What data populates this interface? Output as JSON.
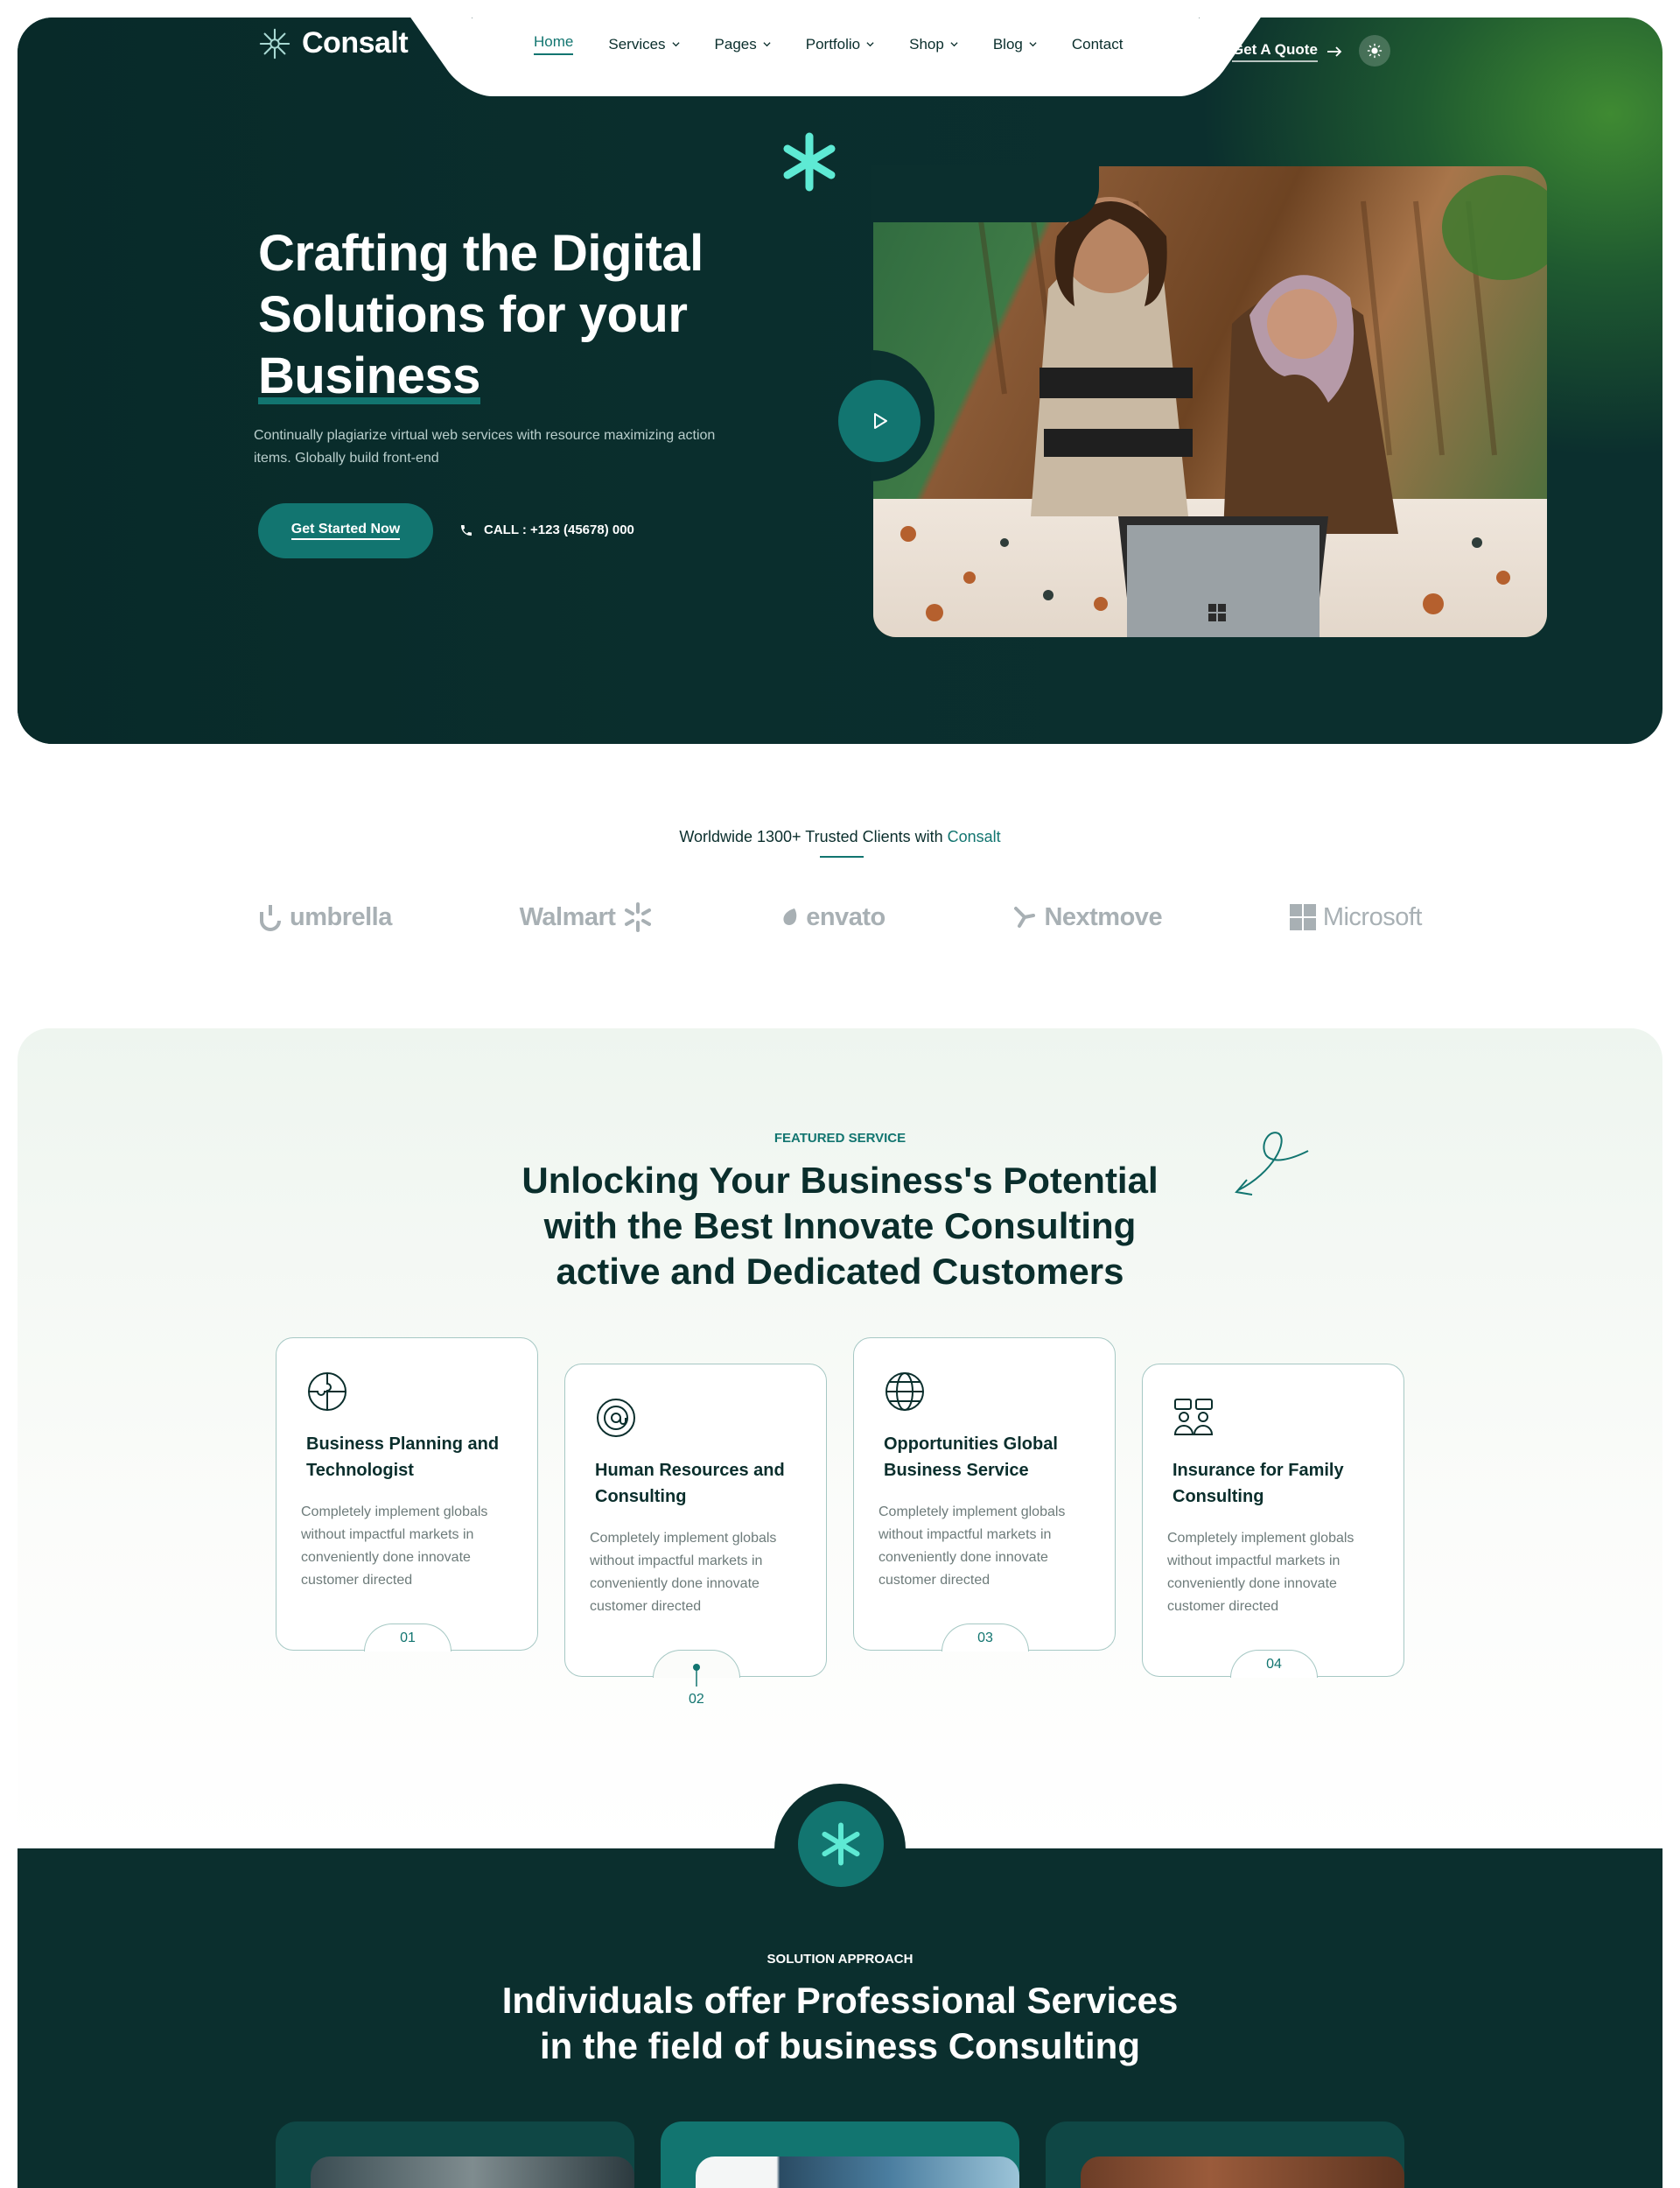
{
  "header": {
    "logo": "Consalt",
    "nav": [
      {
        "label": "Home",
        "active": true,
        "dropdown": false
      },
      {
        "label": "Services",
        "active": false,
        "dropdown": true
      },
      {
        "label": "Pages",
        "active": false,
        "dropdown": true
      },
      {
        "label": "Portfolio",
        "active": false,
        "dropdown": true
      },
      {
        "label": "Shop",
        "active": false,
        "dropdown": true
      },
      {
        "label": "Blog",
        "active": false,
        "dropdown": true
      },
      {
        "label": "Contact",
        "active": false,
        "dropdown": false
      }
    ],
    "quote_label": "Get A Quote",
    "icons": {
      "quote": "arrow-right-icon",
      "theme": "sun-icon"
    }
  },
  "hero": {
    "title_line1": "Crafting the Digital",
    "title_line2": "Solutions for your",
    "title_line3": "Business",
    "subtitle": "Continually plagiarize virtual web services with resource maximizing action items. Globally build front-end",
    "cta_label": "Get Started Now",
    "call_text": "CALL : +123 (45678) 000",
    "icons": {
      "play": "play-icon",
      "phone": "phone-icon",
      "decor": "asterisk-icon"
    }
  },
  "clients": {
    "title_prefix": "Worldwide 1300+ Trusted Clients with ",
    "title_highlight": "Consalt",
    "brands": [
      "umbrella",
      "Walmart",
      "envato",
      "Nextmove",
      "Microsoft"
    ]
  },
  "services": {
    "eyebrow": "FEATURED SERVICE",
    "title": "Unlocking Your Business's Potential with the Best Innovate Consulting active and Dedicated Customers",
    "cards": [
      {
        "num": "01",
        "title": "Business Planning and Technologist",
        "text": "Completely implement globals without impactful markets in conveniently done  innovate customer directed",
        "icon": "puzzle-icon"
      },
      {
        "num": "02",
        "title": "Human Resources and Consulting",
        "text": "Completely implement globals without impactful markets in conveniently done  innovate customer directed",
        "icon": "at-sign-icon"
      },
      {
        "num": "03",
        "title": "Opportunities Global Business Service",
        "text": "Completely implement globals without impactful markets in conveniently done  innovate customer directed",
        "icon": "globe-icon"
      },
      {
        "num": "04",
        "title": "Insurance for Family Consulting",
        "text": "Completely implement globals without impactful markets in conveniently done  innovate customer directed",
        "icon": "team-chat-icon"
      }
    ]
  },
  "solution": {
    "eyebrow": "SOLUTION APPROACH",
    "title": "Individuals offer Professional Services in the field of business Consulting"
  },
  "colors": {
    "dark": "#0b2f2e",
    "accent": "#127570",
    "mint": "#5eead4",
    "green_glow": "#3f8a32"
  }
}
